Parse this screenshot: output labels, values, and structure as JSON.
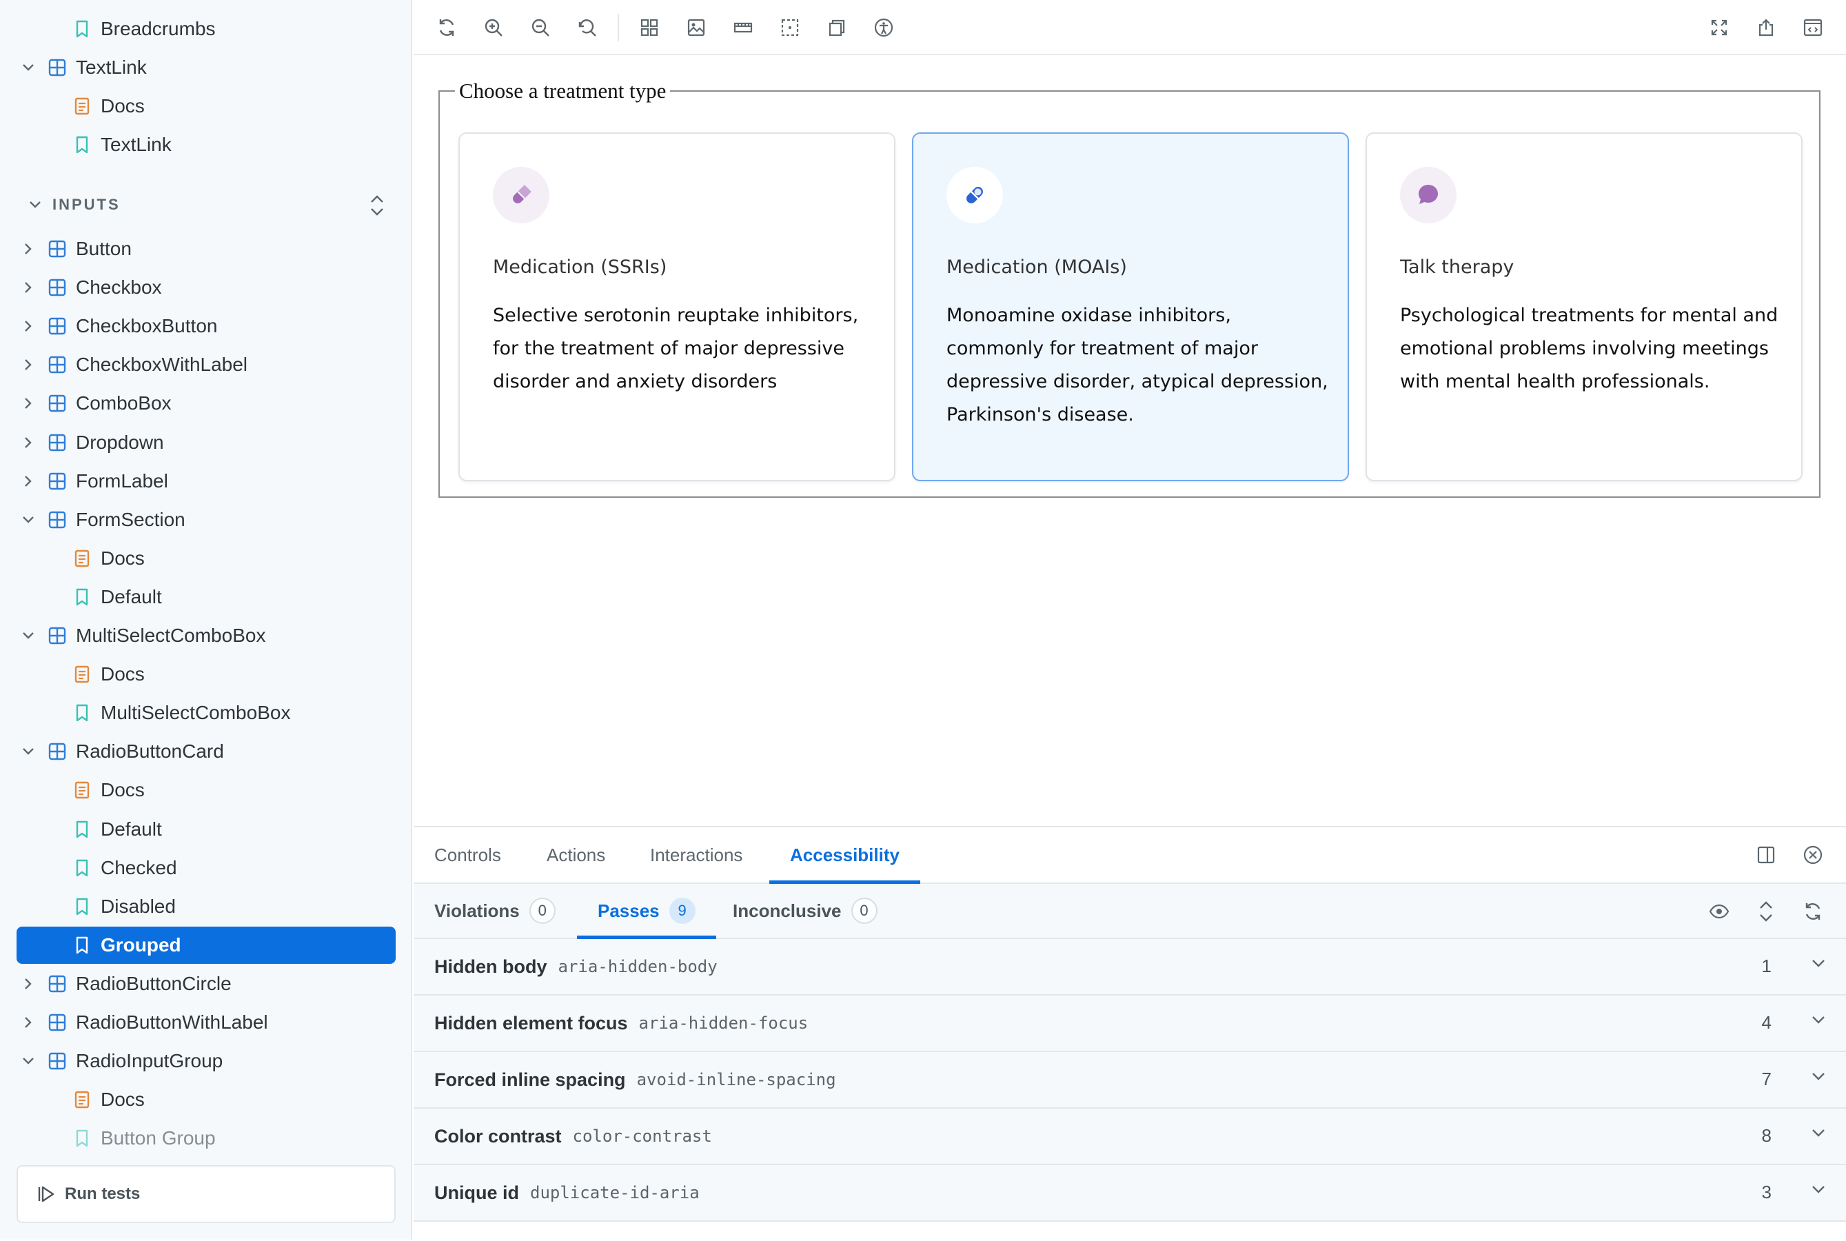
{
  "sidebar": {
    "items": [
      {
        "label": "Breadcrumbs",
        "kind": "story",
        "level": 2
      },
      {
        "label": "TextLink",
        "kind": "component",
        "level": 1,
        "expanded": true
      },
      {
        "label": "Docs",
        "kind": "docs",
        "level": 2
      },
      {
        "label": "TextLink",
        "kind": "story",
        "level": 2
      }
    ],
    "section_title": "INPUTS",
    "inputs": [
      {
        "label": "Button",
        "kind": "component",
        "level": 1,
        "expanded": false
      },
      {
        "label": "Checkbox",
        "kind": "component",
        "level": 1,
        "expanded": false
      },
      {
        "label": "CheckboxButton",
        "kind": "component",
        "level": 1,
        "expanded": false
      },
      {
        "label": "CheckboxWithLabel",
        "kind": "component",
        "level": 1,
        "expanded": false
      },
      {
        "label": "ComboBox",
        "kind": "component",
        "level": 1,
        "expanded": false
      },
      {
        "label": "Dropdown",
        "kind": "component",
        "level": 1,
        "expanded": false
      },
      {
        "label": "FormLabel",
        "kind": "component",
        "level": 1,
        "expanded": false
      },
      {
        "label": "FormSection",
        "kind": "component",
        "level": 1,
        "expanded": true
      },
      {
        "label": "Docs",
        "kind": "docs",
        "level": 2
      },
      {
        "label": "Default",
        "kind": "story",
        "level": 2
      },
      {
        "label": "MultiSelectComboBox",
        "kind": "component",
        "level": 1,
        "expanded": true
      },
      {
        "label": "Docs",
        "kind": "docs",
        "level": 2
      },
      {
        "label": "MultiSelectComboBox",
        "kind": "story",
        "level": 2
      },
      {
        "label": "RadioButtonCard",
        "kind": "component",
        "level": 1,
        "expanded": true
      },
      {
        "label": "Docs",
        "kind": "docs",
        "level": 2
      },
      {
        "label": "Default",
        "kind": "story",
        "level": 2
      },
      {
        "label": "Checked",
        "kind": "story",
        "level": 2
      },
      {
        "label": "Disabled",
        "kind": "story",
        "level": 2
      },
      {
        "label": "Grouped",
        "kind": "story",
        "level": 2,
        "active": true
      },
      {
        "label": "RadioButtonCircle",
        "kind": "component",
        "level": 1,
        "expanded": false
      },
      {
        "label": "RadioButtonWithLabel",
        "kind": "component",
        "level": 1,
        "expanded": false
      },
      {
        "label": "RadioInputGroup",
        "kind": "component",
        "level": 1,
        "expanded": true
      },
      {
        "label": "Docs",
        "kind": "docs",
        "level": 2
      },
      {
        "label": "Button Group",
        "kind": "story",
        "level": 2,
        "faded": true
      }
    ],
    "run_tests_label": "Run tests"
  },
  "toolbar": {
    "left_icons": [
      "reload-icon",
      "zoom-in-icon",
      "zoom-out-icon",
      "zoom-reset-icon",
      "grid-icon",
      "background-icon",
      "ruler-icon",
      "outline-icon",
      "viewport-icon",
      "accessibility-icon"
    ],
    "right_icons": [
      "fullscreen-icon",
      "share-icon",
      "open-in-new-tab-icon"
    ]
  },
  "canvas": {
    "legend": "Choose a treatment type",
    "cards": [
      {
        "title": "Medication (SSRIs)",
        "description": "Selective serotonin reuptake inhibitors, for the treatment of major depressive disorder and anxiety disorders",
        "icon": "pill-icon",
        "selected": false
      },
      {
        "title": "Medication (MOAIs)",
        "description": "Monoamine oxidase inhibitors, commonly for treatment of major depressive disorder, atypical depression, Parkinson's disease.",
        "icon": "pill-icon",
        "selected": true
      },
      {
        "title": "Talk therapy",
        "description": "Psychological treatments for mental and emotional problems involving meetings with mental health professionals.",
        "icon": "chat-bubble-icon",
        "selected": false
      }
    ]
  },
  "panel": {
    "tabs": [
      "Controls",
      "Actions",
      "Interactions",
      "Accessibility"
    ],
    "active_tab": "Accessibility",
    "subtabs": [
      {
        "label": "Violations",
        "count": "0"
      },
      {
        "label": "Passes",
        "count": "9"
      },
      {
        "label": "Inconclusive",
        "count": "0"
      }
    ],
    "active_subtab": "Passes",
    "rules": [
      {
        "name": "Hidden body",
        "id": "aria-hidden-body",
        "count": "1"
      },
      {
        "name": "Hidden element focus",
        "id": "aria-hidden-focus",
        "count": "4"
      },
      {
        "name": "Forced inline spacing",
        "id": "avoid-inline-spacing",
        "count": "7"
      },
      {
        "name": "Color contrast",
        "id": "color-contrast",
        "count": "8"
      },
      {
        "name": "Unique id",
        "id": "duplicate-id-aria",
        "count": "3"
      }
    ]
  },
  "colors": {
    "accent": "#0b6fdf",
    "component_icon": "#2f7ed8",
    "docs_icon": "#e5883a",
    "story_icon": "#37c2b4",
    "ssri_icon": "#a26bb8",
    "moai_icon": "#2a64d4"
  }
}
